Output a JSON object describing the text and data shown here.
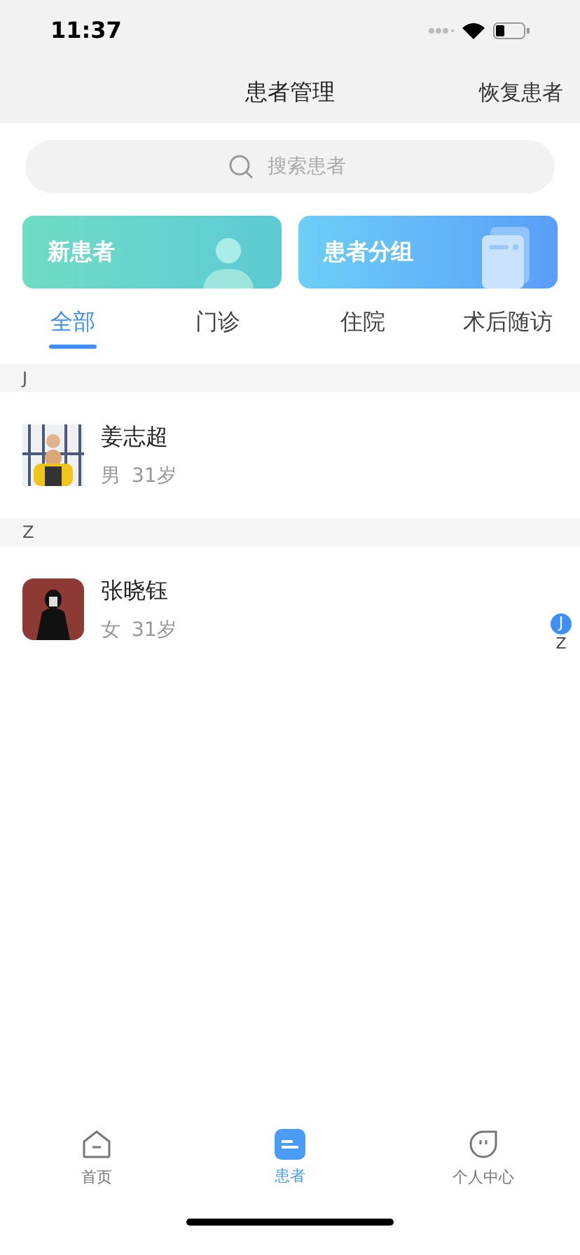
{
  "status_bar": {
    "time": "11:37"
  },
  "nav": {
    "title": "患者管理",
    "action": "恢复患者"
  },
  "search": {
    "placeholder": "搜索患者"
  },
  "cards": [
    {
      "kind": "person",
      "label": "新患者"
    },
    {
      "kind": "group",
      "label": "患者分组"
    }
  ],
  "tabs": [
    {
      "label": "全部",
      "selected": true
    },
    {
      "label": "门诊",
      "selected": false
    },
    {
      "label": "住院",
      "selected": false
    },
    {
      "label": "术后随访",
      "selected": false
    }
  ],
  "sections": [
    {
      "letter": "J",
      "patients": [
        {
          "name": "姜志超",
          "gender": "男",
          "age": "31岁"
        }
      ]
    },
    {
      "letter": "Z",
      "patients": [
        {
          "name": "张晓钰",
          "gender": "女",
          "age": "31岁"
        }
      ]
    }
  ],
  "index_bar": [
    {
      "letter": "J",
      "selected": true
    },
    {
      "letter": "Z",
      "selected": false
    }
  ],
  "tab_bar": [
    {
      "kind": "home",
      "label": "首页",
      "selected": false
    },
    {
      "kind": "patients",
      "label": "患者",
      "selected": true
    },
    {
      "kind": "profile",
      "label": "个人中心",
      "selected": false
    }
  ]
}
